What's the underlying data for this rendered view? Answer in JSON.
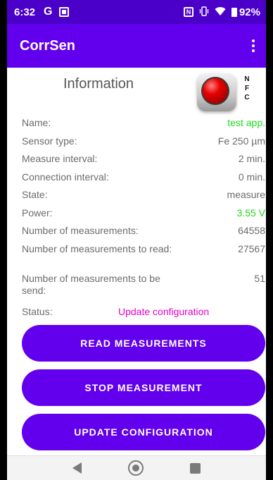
{
  "status_bar": {
    "time": "6:32",
    "g_label": "G",
    "nfc_label": "N",
    "battery": "92%",
    "icons": [
      "google-icon",
      "gallery-icon",
      "nfc-icon",
      "vibrate-icon",
      "wifi-icon",
      "battery-icon"
    ]
  },
  "app_bar": {
    "title": "CorrSen",
    "menu_icon": "overflow-menu-icon",
    "color": "#6200ee"
  },
  "info": {
    "title": "Information",
    "nfc_text": "NFC",
    "nfc_led_color": "#e60000",
    "rows": [
      {
        "label": "Name:",
        "value": "test app.",
        "value_color": "#22d81e"
      },
      {
        "label": "Sensor type:",
        "value": "Fe 250 µm"
      },
      {
        "label": "Measure interval:",
        "value": "2 min."
      },
      {
        "label": "Connection interval:",
        "value": "0 min."
      },
      {
        "label": "State:",
        "value": "measure"
      },
      {
        "label": "Power:",
        "value": "3.55 V",
        "value_color": "#22d81e"
      },
      {
        "label": "Number of measurements:",
        "value": "64558"
      },
      {
        "label": "Number of measurements to read:",
        "value": "27567"
      },
      {
        "label": "Number of measurements to be send:",
        "value": "51"
      }
    ],
    "status_label": "Status:",
    "status_value": "Update configuration",
    "status_color": "#e600c8"
  },
  "actions": {
    "read": "READ MEASUREMENTS",
    "stop": "STOP MEASUREMENT",
    "update": "UPDATE CONFIGURATION"
  },
  "nav": {
    "icons": [
      "back-icon",
      "home-icon",
      "recents-icon"
    ]
  }
}
